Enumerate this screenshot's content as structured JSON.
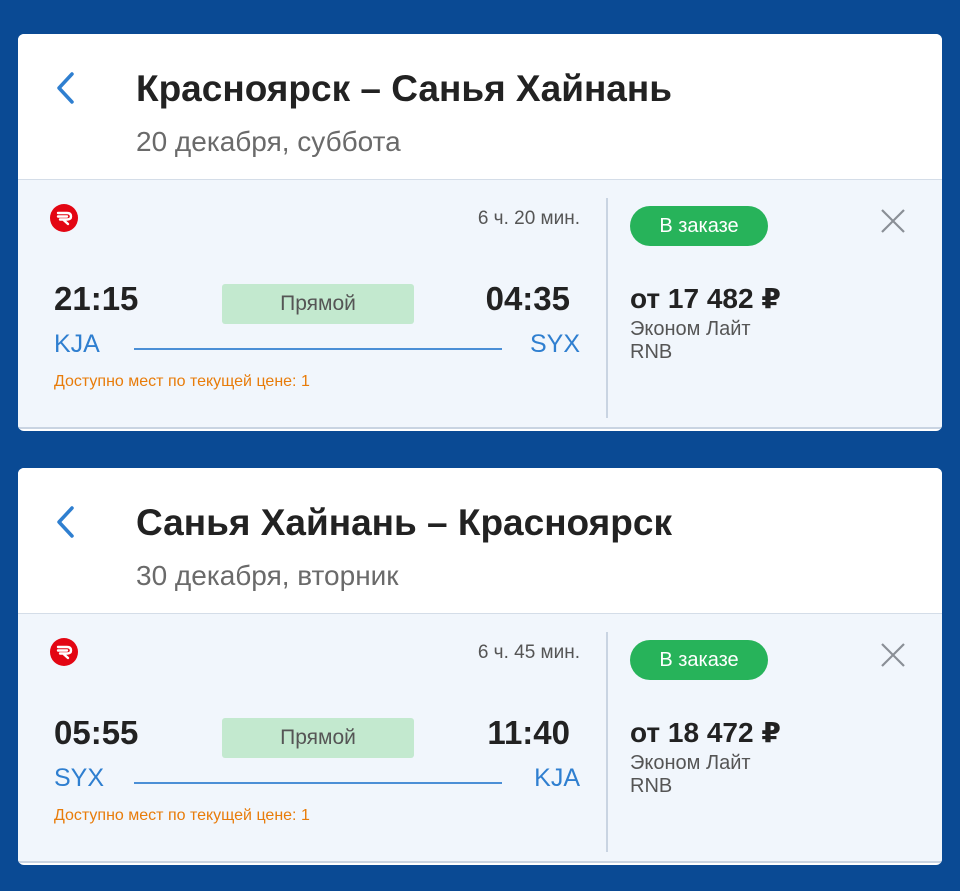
{
  "colors": {
    "background": "#0a4a94",
    "accent_blue": "#2f7fd0",
    "status_green": "#27b35a",
    "badge_green": "#c3e9cf",
    "seats_orange": "#e87c0a",
    "logo_red": "#e30613"
  },
  "icons": {
    "back": "chevron-left-icon",
    "close": "close-icon",
    "airline": "airline-logo-icon"
  },
  "cards": [
    {
      "title": "Красноярск – Санья Хайнань",
      "date": "20 декабря, суббота",
      "flight": {
        "duration": "6 ч. 20 мин.",
        "dep_time": "21:15",
        "arr_time": "04:35",
        "dep_code": "KJA",
        "arr_code": "SYX",
        "type": "Прямой",
        "seats": "Доступно мест по текущей цене: 1",
        "status": "В заказе",
        "price": "от 17 482 ₽",
        "fare": "Эконом Лайт",
        "fare_code": "RNB"
      }
    },
    {
      "title": "Санья Хайнань – Красноярск",
      "date": "30 декабря, вторник",
      "flight": {
        "duration": "6 ч. 45 мин.",
        "dep_time": "05:55",
        "arr_time": "11:40",
        "dep_code": "SYX",
        "arr_code": "KJA",
        "type": "Прямой",
        "seats": "Доступно мест по текущей цене: 1",
        "status": "В заказе",
        "price": "от 18 472 ₽",
        "fare": "Эконом Лайт",
        "fare_code": "RNB"
      }
    }
  ]
}
